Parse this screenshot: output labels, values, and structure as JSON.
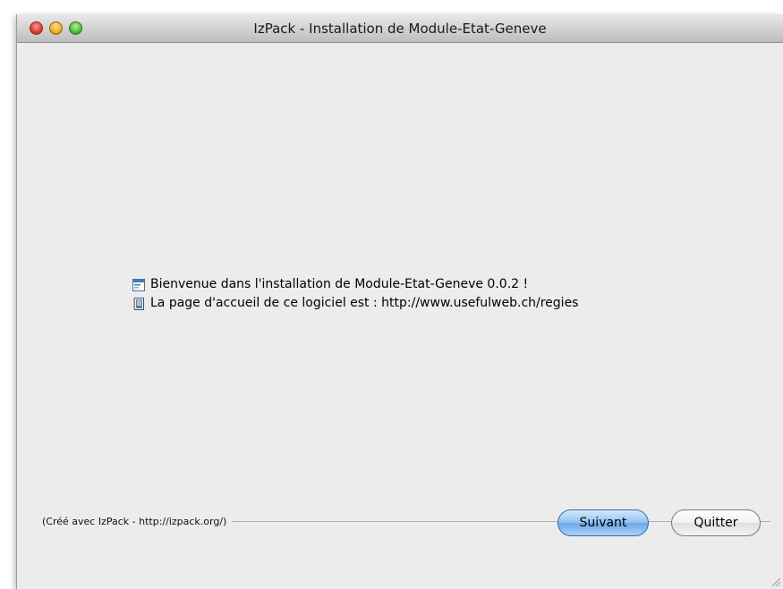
{
  "window": {
    "title": "IzPack - Installation de Module-Etat-Geneve"
  },
  "info": {
    "welcome": "Bienvenue dans l'installation de Module-Etat-Geneve 0.0.2 !",
    "homepage": "La page d'accueil de ce logiciel est : http://www.usefulweb.ch/regies"
  },
  "footer": {
    "credit": "(Créé avec IzPack - http://izpack.org/)"
  },
  "buttons": {
    "next_label": "Suivant",
    "quit_label": "Quitter"
  },
  "icons": {
    "close": "close-icon",
    "minimize": "minimize-icon",
    "zoom": "zoom-icon",
    "welcome": "application-icon",
    "homepage": "document-icon",
    "resize": "resize-grip-icon"
  },
  "colors": {
    "primary_button": "#8fc1f0",
    "window_bg": "#ececec"
  }
}
